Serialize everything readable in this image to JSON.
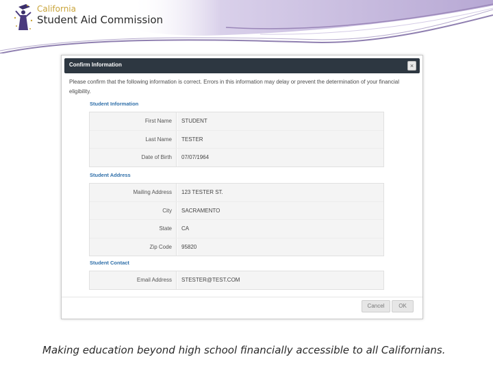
{
  "header": {
    "org_small": "California",
    "org_big": "Student Aid Commission",
    "logo_icon": "graduate-figure-icon"
  },
  "dialog": {
    "title": "Confirm Information",
    "close_icon": "close-icon",
    "close_glyph": "×",
    "intro": "Please confirm that the following information is correct. Errors in this information may delay or prevent the determination of your financial eligibility.",
    "sections": [
      {
        "label": "Student Information",
        "rows": [
          {
            "label": "First Name",
            "value": "STUDENT"
          },
          {
            "label": "Last Name",
            "value": "TESTER"
          },
          {
            "label": "Date of Birth",
            "value": "07/07/1964"
          }
        ]
      },
      {
        "label": "Student Address",
        "rows": [
          {
            "label": "Mailing Address",
            "value": "123 TESTER ST."
          },
          {
            "label": "City",
            "value": "SACRAMENTO"
          },
          {
            "label": "State",
            "value": "CA"
          },
          {
            "label": "Zip Code",
            "value": "95820"
          }
        ]
      },
      {
        "label": "Student Contact",
        "rows": [
          {
            "label": "Email Address",
            "value": "STESTER@TEST.COM"
          }
        ]
      }
    ],
    "buttons": {
      "cancel": "Cancel",
      "ok": "OK"
    }
  },
  "tagline": "Making education beyond high school financially accessible to all Californians.",
  "colors": {
    "titlebar": "#2d3741",
    "section_label": "#2f6fa9",
    "header_swoosh": "#9a86b8",
    "header_gold": "#c9a43a"
  }
}
